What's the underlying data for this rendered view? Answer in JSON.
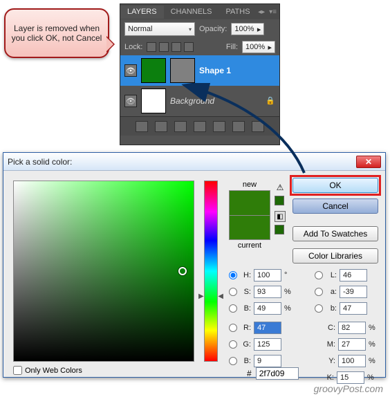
{
  "callout": {
    "text": "Layer is removed when you click OK, not Cancel"
  },
  "layers_panel": {
    "tabs": {
      "layers": "LAYERS",
      "channels": "CHANNELS",
      "paths": "PATHS"
    },
    "blend_mode": "Normal",
    "opacity_label": "Opacity:",
    "opacity_value": "100%",
    "lock_label": "Lock:",
    "fill_label": "Fill:",
    "fill_value": "100%",
    "items": [
      {
        "name": "Shape 1"
      },
      {
        "name": "Background"
      }
    ]
  },
  "color_picker": {
    "title": "Pick a solid color:",
    "new_label": "new",
    "current_label": "current",
    "buttons": {
      "ok": "OK",
      "cancel": "Cancel",
      "add_swatches": "Add To Swatches",
      "color_libraries": "Color Libraries"
    },
    "only_web_colors": "Only Web Colors",
    "fields": {
      "H": "100",
      "H_unit": "°",
      "S": "93",
      "S_unit": "%",
      "Bhsb": "49",
      "Bhsb_unit": "%",
      "R": "47",
      "G": "125",
      "Bi": "9",
      "L": "46",
      "a": "-39",
      "b_lab": "47",
      "C": "82",
      "C_unit": "%",
      "M": "27",
      "M_unit": "%",
      "Y": "100",
      "Y_unit": "%",
      "K": "15",
      "K_unit": "%"
    },
    "hex_label": "#",
    "hex": "2f7d09"
  },
  "watermark": "groovyPost.com"
}
